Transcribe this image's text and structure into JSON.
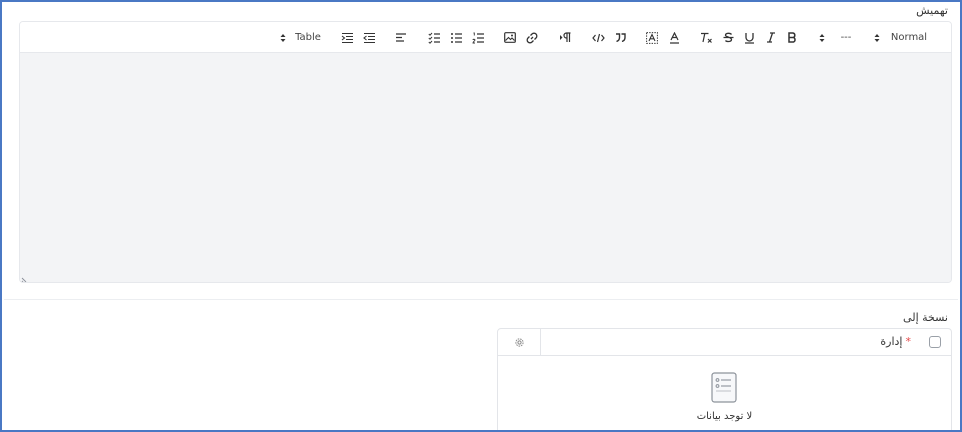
{
  "margin_section": {
    "label": "تهميش"
  },
  "toolbar": {
    "header_select": "Normal",
    "size_select": "---",
    "table_select": "Table"
  },
  "icons": {
    "bold": "bold-icon",
    "italic": "italic-icon",
    "underline": "underline-icon",
    "strike": "strikethrough-icon",
    "clear": "clear-format-icon",
    "color": "font-color-icon",
    "background": "background-color-icon",
    "quote": "blockquote-icon",
    "code": "code-icon",
    "direction": "text-direction-icon",
    "link": "link-icon",
    "image": "image-icon",
    "ordered": "ordered-list-icon",
    "bullet": "bullet-list-icon",
    "check": "check-list-icon",
    "align": "align-icon",
    "outdent": "outdent-icon",
    "indent": "indent-icon"
  },
  "copy_section": {
    "label": "نسخة إلى",
    "column_title": "إدارة",
    "required_mark": "*",
    "empty_text": "لا توجد بيانات"
  }
}
